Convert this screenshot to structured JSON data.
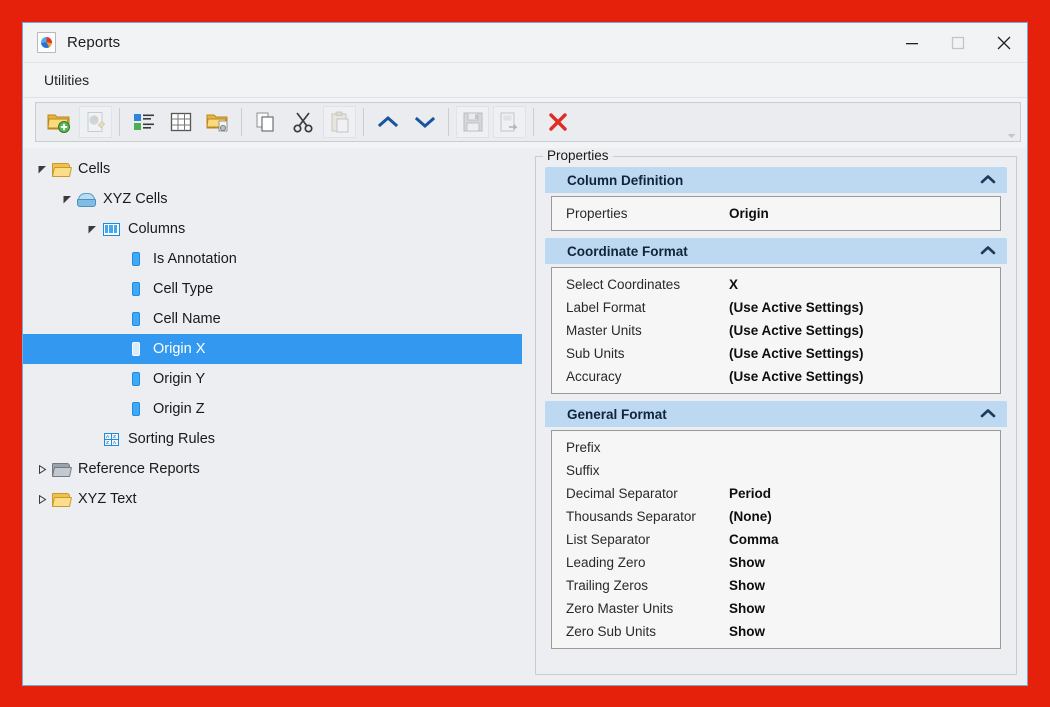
{
  "window": {
    "title": "Reports",
    "app_icon": "report-document-icon",
    "controls": {
      "minimize": "minimize-button",
      "maximize": "maximize-button",
      "close": "close-button"
    },
    "accent_border": "#7aa7d8",
    "desktop_background": "#e5210c"
  },
  "menubar": {
    "items": [
      {
        "label": "Utilities"
      }
    ]
  },
  "toolbar": {
    "overflow_icon": "toolbar-overflow-chevron",
    "buttons": [
      {
        "name": "new-report-folder-button",
        "icon": "folder-add-icon",
        "enabled": true,
        "framed": false
      },
      {
        "name": "new-report-button",
        "icon": "report-page-add-icon",
        "enabled": false,
        "framed": true
      },
      {
        "sep": true
      },
      {
        "name": "list-view-button",
        "icon": "list-view-icon",
        "enabled": true,
        "framed": false
      },
      {
        "name": "table-view-button",
        "icon": "table-grid-icon",
        "enabled": true,
        "framed": false
      },
      {
        "name": "folder-properties-button",
        "icon": "folder-settings-icon",
        "enabled": true,
        "framed": false
      },
      {
        "sep": true
      },
      {
        "name": "copy-button",
        "icon": "copy-icon",
        "enabled": true,
        "framed": false
      },
      {
        "name": "cut-button",
        "icon": "scissors-icon",
        "enabled": true,
        "framed": false
      },
      {
        "name": "paste-button",
        "icon": "clipboard-paste-icon",
        "enabled": false,
        "framed": true
      },
      {
        "sep": true
      },
      {
        "name": "move-up-button",
        "icon": "chevron-up-icon",
        "enabled": true,
        "framed": false
      },
      {
        "name": "move-down-button",
        "icon": "chevron-down-icon",
        "enabled": true,
        "framed": false
      },
      {
        "sep": true
      },
      {
        "name": "save-button",
        "icon": "floppy-save-icon",
        "enabled": false,
        "framed": true
      },
      {
        "name": "save-as-button",
        "icon": "save-as-icon",
        "enabled": false,
        "framed": true
      },
      {
        "sep": true
      },
      {
        "name": "delete-button",
        "icon": "red-x-delete-icon",
        "enabled": true,
        "framed": false
      }
    ]
  },
  "tree": {
    "selection_color": "#3399f0",
    "items": [
      {
        "label": "Cells",
        "depth": 0,
        "twisty": "expanded",
        "icon": "folder-open-yellow-icon",
        "selected": false
      },
      {
        "label": "XYZ Cells",
        "depth": 1,
        "twisty": "expanded",
        "icon": "stack-blue-icon",
        "selected": false
      },
      {
        "label": "Columns",
        "depth": 2,
        "twisty": "expanded",
        "icon": "columns-blue-icon",
        "selected": false
      },
      {
        "label": "Is Annotation",
        "depth": 3,
        "twisty": "none",
        "icon": "field-blue-icon",
        "selected": false
      },
      {
        "label": "Cell Type",
        "depth": 3,
        "twisty": "none",
        "icon": "field-blue-icon",
        "selected": false
      },
      {
        "label": "Cell Name",
        "depth": 3,
        "twisty": "none",
        "icon": "field-blue-icon",
        "selected": false
      },
      {
        "label": "Origin X",
        "depth": 3,
        "twisty": "none",
        "icon": "field-blue-icon",
        "selected": true
      },
      {
        "label": "Origin Y",
        "depth": 3,
        "twisty": "none",
        "icon": "field-blue-icon",
        "selected": false
      },
      {
        "label": "Origin Z",
        "depth": 3,
        "twisty": "none",
        "icon": "field-blue-icon",
        "selected": false
      },
      {
        "label": "Sorting Rules",
        "depth": 2,
        "twisty": "none",
        "icon": "sorting-rules-icon",
        "selected": false
      },
      {
        "label": "Reference Reports",
        "depth": 0,
        "twisty": "collapsed",
        "icon": "folder-closed-gray-icon",
        "selected": false
      },
      {
        "label": "XYZ Text",
        "depth": 0,
        "twisty": "collapsed",
        "icon": "folder-open-yellow-icon",
        "selected": false
      }
    ]
  },
  "properties": {
    "legend": "Properties",
    "header_color": "#bdd9f2",
    "sections": [
      {
        "title": "Column Definition",
        "collapse_icon": "chevron-up-icon",
        "rows": [
          {
            "name": "Properties",
            "value": "Origin"
          }
        ]
      },
      {
        "title": "Coordinate Format",
        "collapse_icon": "chevron-up-icon",
        "rows": [
          {
            "name": "Select Coordinates",
            "value": "X"
          },
          {
            "name": "Label Format",
            "value": "(Use Active Settings)"
          },
          {
            "name": "Master Units",
            "value": "(Use Active Settings)"
          },
          {
            "name": "Sub Units",
            "value": "(Use Active Settings)"
          },
          {
            "name": "Accuracy",
            "value": "(Use Active Settings)"
          }
        ]
      },
      {
        "title": "General Format",
        "collapse_icon": "chevron-up-icon",
        "rows": [
          {
            "name": "Prefix",
            "value": ""
          },
          {
            "name": "Suffix",
            "value": ""
          },
          {
            "name": "Decimal Separator",
            "value": "Period"
          },
          {
            "name": "Thousands Separator",
            "value": "(None)"
          },
          {
            "name": "List Separator",
            "value": "Comma"
          },
          {
            "name": "Leading Zero",
            "value": "Show"
          },
          {
            "name": "Trailing Zeros",
            "value": "Show"
          },
          {
            "name": "Zero Master Units",
            "value": "Show"
          },
          {
            "name": "Zero Sub Units",
            "value": "Show"
          }
        ]
      }
    ]
  }
}
